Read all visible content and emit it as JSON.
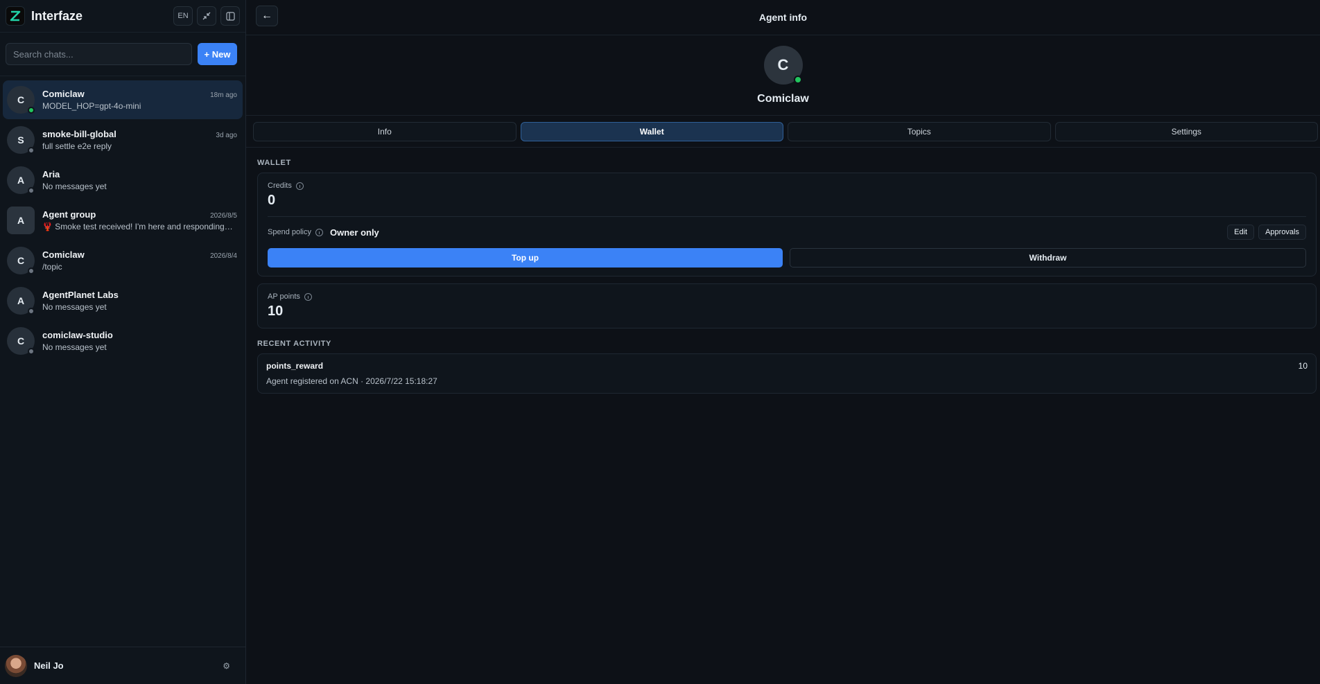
{
  "app": {
    "name": "Interfaze",
    "lang_label": "EN"
  },
  "search": {
    "placeholder": "Search chats..."
  },
  "new_button": "+ New",
  "chats": [
    {
      "initial": "C",
      "name": "Comiclaw",
      "preview": "MODEL_HOP=gpt-4o-mini",
      "time": "18m ago",
      "online": true,
      "active": true
    },
    {
      "initial": "S",
      "name": "smoke-bill-global",
      "preview": "full settle e2e reply",
      "time": "3d ago",
      "online": false
    },
    {
      "initial": "A",
      "name": "Aria",
      "preview": "No messages yet",
      "time": "",
      "online": false
    },
    {
      "initial": "A",
      "name": "Agent group",
      "preview": "🦞 Smoke test received! I'm here and responding…",
      "time": "2026/8/5",
      "online": false,
      "group": true
    },
    {
      "initial": "C",
      "name": "Comiclaw",
      "preview": "/topic",
      "time": "2026/8/4",
      "online": false
    },
    {
      "initial": "A",
      "name": "AgentPlanet Labs",
      "preview": "No messages yet",
      "time": "",
      "online": false
    },
    {
      "initial": "C",
      "name": "comiclaw-studio",
      "preview": "No messages yet",
      "time": "",
      "online": false
    }
  ],
  "user": {
    "name": "Neil Jo"
  },
  "header": {
    "title": "Agent info",
    "back_icon": "←"
  },
  "agent": {
    "initial": "C",
    "name": "Comiclaw"
  },
  "tabs": [
    {
      "label": "Info",
      "active": false
    },
    {
      "label": "Wallet",
      "active": true
    },
    {
      "label": "Topics",
      "active": false
    },
    {
      "label": "Settings",
      "active": false
    }
  ],
  "wallet": {
    "section_title": "WALLET",
    "credits_label": "Credits",
    "credits_value": "0",
    "spend_policy_label": "Spend policy",
    "spend_policy_value": "Owner only",
    "edit_label": "Edit",
    "approvals_label": "Approvals",
    "topup_label": "Top up",
    "withdraw_label": "Withdraw",
    "ap_points_label": "AP points",
    "ap_points_value": "10"
  },
  "activity": {
    "section_title": "RECENT ACTIVITY",
    "items": [
      {
        "title": "points_reward",
        "subtitle": "Agent registered on ACN · 2026/7/22 15:18:27",
        "amount": "10"
      }
    ]
  },
  "colors": {
    "accent": "#3b82f6",
    "online": "#22c55e",
    "background": "#0d1117"
  }
}
